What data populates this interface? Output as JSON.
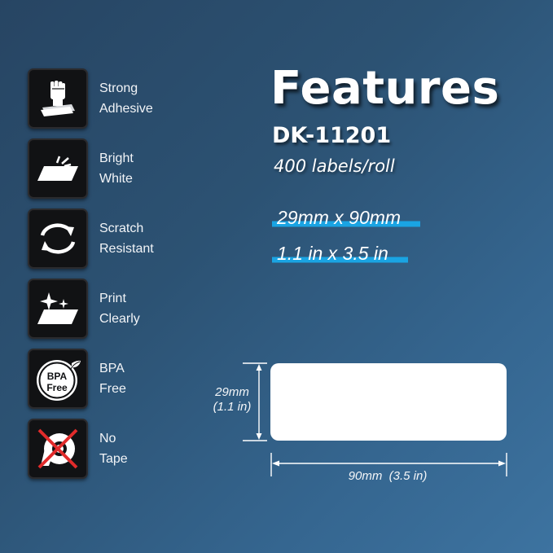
{
  "features": [
    {
      "line1": "Strong",
      "line2": "Adhesive",
      "icon": "fist-icon"
    },
    {
      "line1": "Bright",
      "line2": "White",
      "icon": "shining-label-icon"
    },
    {
      "line1": "Scratch",
      "line2": "Resistant",
      "icon": "refresh-arrows-icon"
    },
    {
      "line1": "Print",
      "line2": "Clearly",
      "icon": "sparkle-label-icon"
    },
    {
      "line1": "BPA",
      "line2": "Free",
      "icon": "bpa-free-badge-icon",
      "badge_line1": "BPA",
      "badge_line2": "Free"
    },
    {
      "line1": "No",
      "line2": "Tape",
      "icon": "no-tape-icon"
    }
  ],
  "title": "Features",
  "model": "DK-11201",
  "count": "400 labels/roll",
  "dimensions": {
    "metric": "29mm x 90mm",
    "imperial": "1.1 in x 3.5 in"
  },
  "diagram": {
    "height_mm": "29mm",
    "height_in": "(1.1 in)",
    "width": "90mm  (3.5 in)"
  },
  "colors": {
    "accent": "#1aa4e3",
    "icon_bg": "#111214",
    "background": "#2c5273"
  }
}
